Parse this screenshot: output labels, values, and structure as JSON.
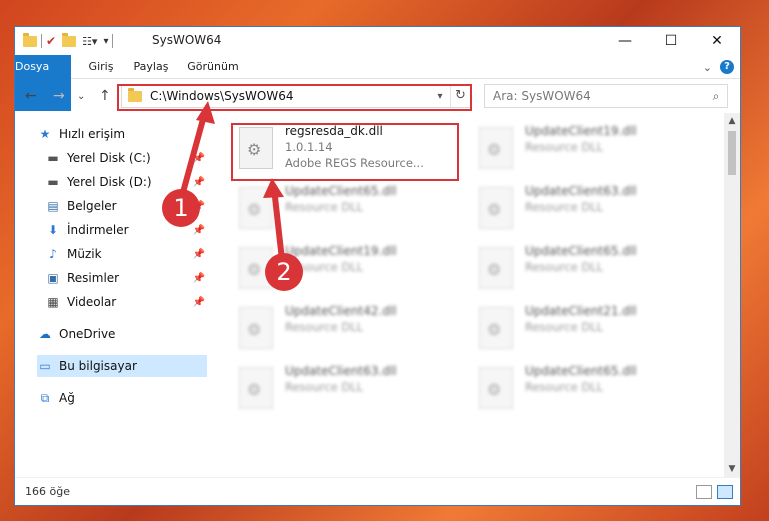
{
  "window": {
    "title": "SysWOW64",
    "controls": {
      "minimize": "—",
      "maximize": "☐",
      "close": "✕"
    }
  },
  "ribbon": {
    "tabs": [
      "Dosya",
      "Giriş",
      "Paylaş",
      "Görünüm"
    ],
    "help": "?",
    "expand": "⌄"
  },
  "nav": {
    "back": "←",
    "forward": "→",
    "recent": "⌄",
    "up": "↑",
    "address": "C:\\Windows\\SysWOW64",
    "search_placeholder": "Ara: SysWOW64"
  },
  "sidebar": {
    "items": [
      {
        "label": "Hızlı erişim",
        "icon": "star-icon",
        "pinned": false
      },
      {
        "label": "Yerel Disk (C:)",
        "icon": "drive-icon",
        "pinned": true
      },
      {
        "label": "Yerel Disk (D:)",
        "icon": "drive-icon",
        "pinned": true
      },
      {
        "label": "Belgeler",
        "icon": "documents-icon",
        "pinned": true
      },
      {
        "label": "İndirmeler",
        "icon": "download-icon",
        "pinned": true
      },
      {
        "label": "Müzik",
        "icon": "music-icon",
        "pinned": true
      },
      {
        "label": "Resimler",
        "icon": "pictures-icon",
        "pinned": true
      },
      {
        "label": "Videolar",
        "icon": "videos-icon",
        "pinned": true
      },
      {
        "label": "OneDrive",
        "icon": "cloud-icon",
        "pinned": false
      },
      {
        "label": "Bu bilgisayar",
        "icon": "computer-icon",
        "pinned": false
      },
      {
        "label": "Ağ",
        "icon": "network-icon",
        "pinned": false
      }
    ]
  },
  "files": [
    {
      "name": "regsresda_dk.dll",
      "line2": "1.0.1.14",
      "line3": "Adobe REGS Resource..."
    },
    {
      "name": "UpdateClient19.dll",
      "line2": "Resource DLL"
    },
    {
      "name": "UpdateClient65.dll",
      "line2": "Resource DLL"
    },
    {
      "name": "UpdateClient63.dll",
      "line2": "Resource DLL"
    },
    {
      "name": "UpdateClient19.dll",
      "line2": "Resource DLL"
    },
    {
      "name": "UpdateClient65.dll",
      "line2": "Resource DLL"
    },
    {
      "name": "UpdateClient42.dll",
      "line2": "Resource DLL"
    },
    {
      "name": "UpdateClient21.dll",
      "line2": "Resource DLL"
    },
    {
      "name": "UpdateClient63.dll",
      "line2": "Resource DLL"
    },
    {
      "name": "UpdateClient65.dll",
      "line2": "Resource DLL"
    }
  ],
  "status": {
    "count": "166 öğe"
  },
  "annotations": {
    "badge1": "1",
    "badge2": "2",
    "color": "#d93438"
  }
}
